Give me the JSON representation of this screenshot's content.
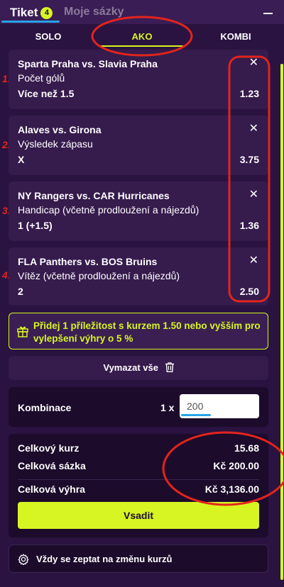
{
  "header": {
    "tab_ticket": "Tiket",
    "ticket_count": "4",
    "tab_my_bets": "Moje sázky"
  },
  "modes": [
    "SOLO",
    "AKO",
    "KOMBI"
  ],
  "active_mode": "AKO",
  "bets": [
    {
      "num": "1.",
      "match": "Sparta Praha vs. Slavia Praha",
      "market": "Počet gólů",
      "selection": "Více než 1.5",
      "odds": "1.23"
    },
    {
      "num": "2.",
      "match": "Alaves vs. Girona",
      "market": "Výsledek zápasu",
      "selection": "X",
      "odds": "3.75"
    },
    {
      "num": "3.",
      "match": "NY Rangers vs. CAR Hurricanes",
      "market": "Handicap (včetně prodloužení a nájezdů)",
      "selection": "1 (+1.5)",
      "odds": "1.36"
    },
    {
      "num": "4.",
      "match": "FLA Panthers vs. BOS Bruins",
      "market": "Vítěz (včetně prodloužení a nájezdů)",
      "selection": "2",
      "odds": "2.50"
    }
  ],
  "close_symbol": "✕",
  "promo": {
    "text": "Přidej 1 příležitost s kurzem 1.50 nebo vyšším pro vylepšení výhry o 5 %"
  },
  "clear_all": "Vymazat vše",
  "combination": {
    "label": "Kombinace",
    "multiplier": "1 x",
    "stake_value": "200"
  },
  "summary": {
    "total_odds_label": "Celkový kurz",
    "total_odds": "15.68",
    "total_stake_label": "Celková sázka",
    "total_stake": "Kč 200.00",
    "total_win_label": "Celková výhra",
    "total_win": "Kč 3,136.00"
  },
  "place_bet": "Vsadit",
  "always_ask": "Vždy se zeptat na změnu kurzů",
  "colors": {
    "accent": "#d7f523",
    "background": "#2a1340",
    "card": "#361b4d",
    "annotation": "#e2241c",
    "tab_underline": "#27a4e8"
  }
}
